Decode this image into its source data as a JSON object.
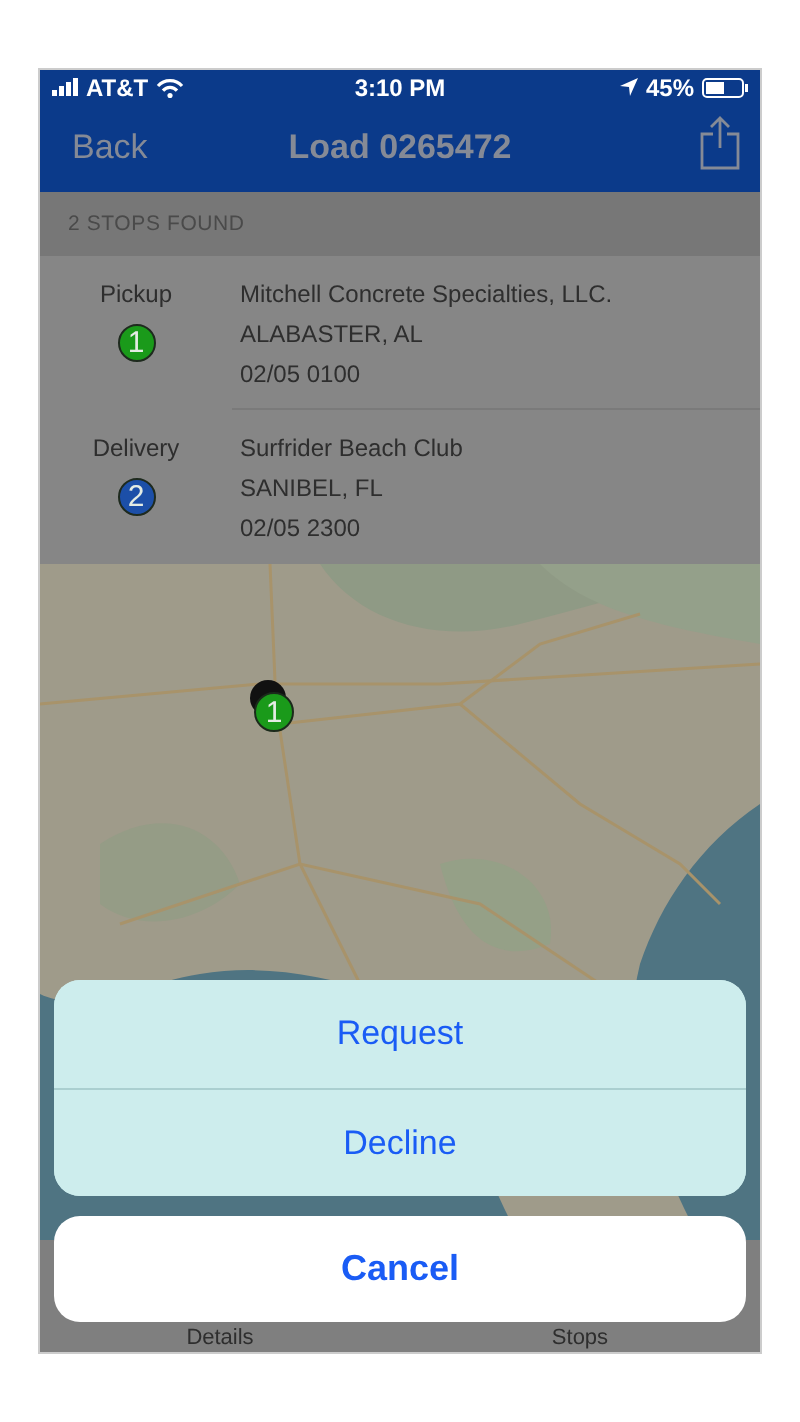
{
  "status_bar": {
    "carrier": "AT&T",
    "time": "3:10 PM",
    "battery": "45%"
  },
  "nav_bar": {
    "back": "Back",
    "title": "Load 0265472"
  },
  "stops_header": "2 STOPS FOUND",
  "stops": [
    {
      "type": "Pickup",
      "number": "1",
      "color": "#1a9a1a",
      "name": "Mitchell Concrete Specialties, LLC.",
      "city": "ALABASTER, AL",
      "time": "02/05 0100"
    },
    {
      "type": "Delivery",
      "number": "2",
      "color": "#1c4fa8",
      "name": "Surfrider Beach Club",
      "city": "SANIBEL, FL",
      "time": "02/05 2300"
    }
  ],
  "map": {
    "pin": {
      "label": "1",
      "color": "#1a9a1a"
    }
  },
  "action_sheet": {
    "actions": [
      "Request",
      "Decline"
    ],
    "cancel": "Cancel"
  },
  "tab_bar": [
    {
      "label": "Details"
    },
    {
      "label": "Stops"
    }
  ]
}
